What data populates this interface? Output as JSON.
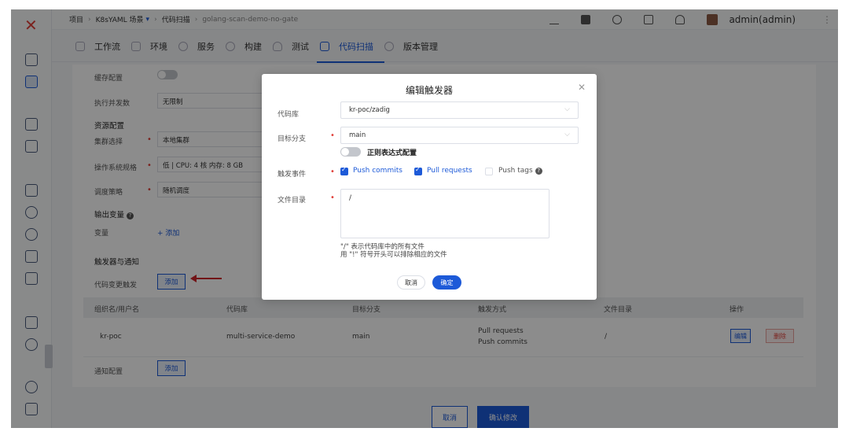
{
  "breadcrumb": {
    "project": "项目",
    "workflow": "K8sYAML 场景",
    "section": "代码扫描",
    "item": "golang-scan-demo-no-gate"
  },
  "user": {
    "name": "admin(admin)"
  },
  "tabs": [
    {
      "label": "工作流"
    },
    {
      "label": "环境"
    },
    {
      "label": "服务"
    },
    {
      "label": "构建"
    },
    {
      "label": "测试"
    },
    {
      "label": "代码扫描"
    },
    {
      "label": "版本管理"
    }
  ],
  "form": {
    "cache_label": "缓存配置",
    "concurrency_label": "执行并发数",
    "concurrency_value": "无限制",
    "resources_heading": "资源配置",
    "cluster_label": "集群选择",
    "cluster_value": "本地集群",
    "os_label": "操作系统规格",
    "os_value": "低 | CPU: 4 核 内存: 8 GB",
    "schedule_label": "调度策略",
    "schedule_value": "随机调度",
    "output_heading": "输出变量",
    "var_label": "变量",
    "var_add": "+ 添加",
    "trigger_heading": "触发器与通知",
    "code_change_label": "代码变更触发",
    "add_label": "添加",
    "notify_label": "通知配置",
    "notify_add": "添加"
  },
  "table": {
    "headers": [
      "组织名/用户名",
      "代码库",
      "目标分支",
      "触发方式",
      "文件目录",
      "操作"
    ],
    "row": {
      "org": "kr-poc",
      "repo": "multi-service-demo",
      "branch": "main",
      "trigger1": "Pull requests",
      "trigger2": "Push commits",
      "dir": "/",
      "edit": "编辑",
      "delete": "删除"
    }
  },
  "footer": {
    "cancel": "取消",
    "confirm": "确认修改"
  },
  "modal": {
    "title": "编辑触发器",
    "repo_label": "代码库",
    "repo_value": "kr-poc/zadig",
    "branch_label": "目标分支",
    "branch_value": "main",
    "regex_label": "正则表达式配置",
    "events_label": "触发事件",
    "event_push": "Push commits",
    "event_pr": "Pull requests",
    "event_tags": "Push tags",
    "dir_label": "文件目录",
    "dir_value": "/",
    "hint1": "\"/\" 表示代码库中的所有文件",
    "hint2": "用 \"!\" 符号开头可以排除相应的文件",
    "cancel": "取消",
    "ok": "确定",
    "event_push_checked": true,
    "event_pr_checked": true,
    "event_tags_checked": false
  }
}
